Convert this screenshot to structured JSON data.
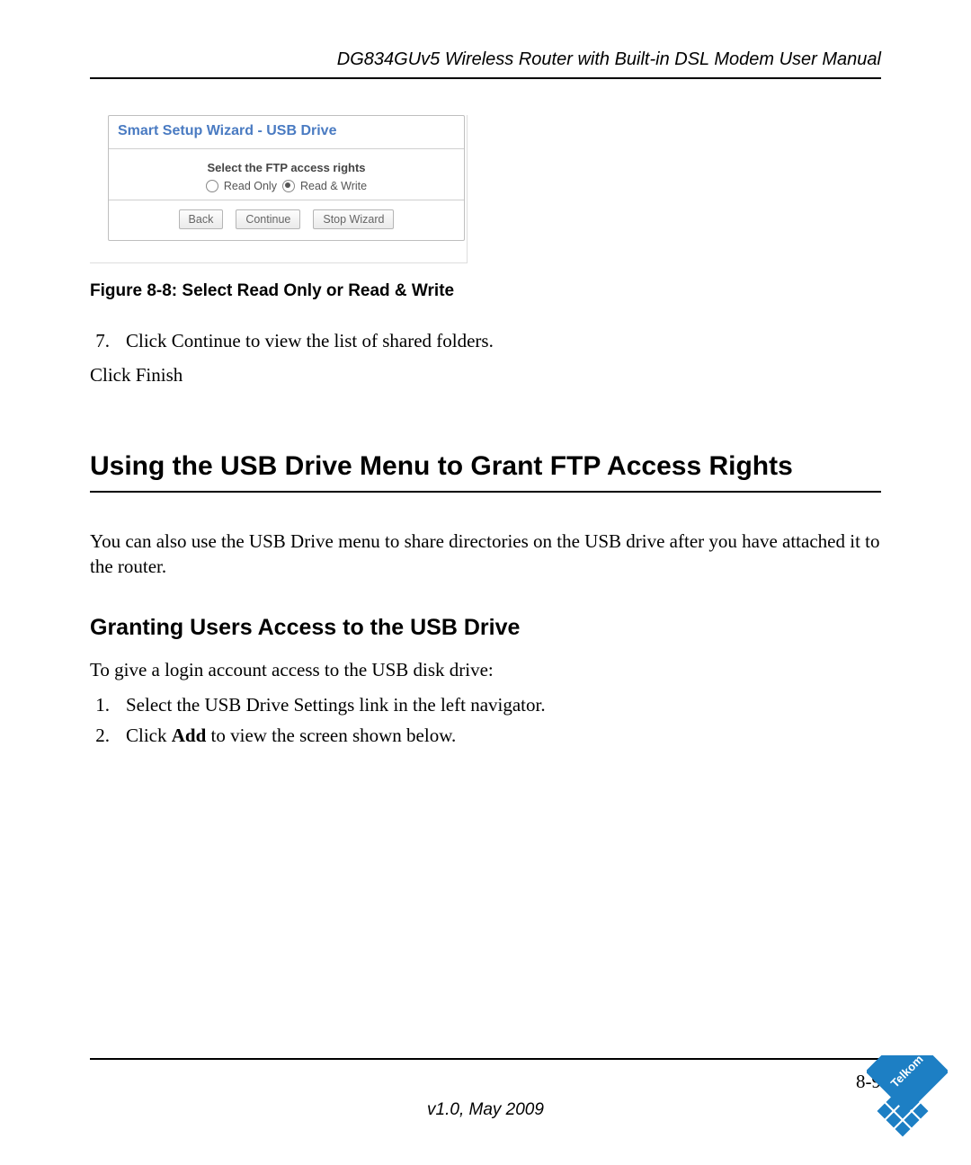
{
  "header": {
    "running_title": "DG834GUv5 Wireless Router with Built-in DSL Modem User Manual"
  },
  "wizard": {
    "title": "Smart Setup Wizard - USB Drive",
    "prompt": "Select the FTP access rights",
    "options": {
      "read_only": "Read Only",
      "read_write": "Read & Write",
      "selected": "read_write"
    },
    "buttons": {
      "back": "Back",
      "continue": "Continue",
      "stop": "Stop Wizard"
    }
  },
  "figure_caption": "Figure 8-8:  Select Read Only or Read & Write",
  "step7": {
    "number": "7.",
    "text": "Click Continue to view the list of shared folders."
  },
  "click_finish": "Click Finish",
  "section_title": "Using the USB Drive Menu to Grant FTP Access Rights",
  "section_intro": "You can also use the USB Drive menu to share directories on the USB drive after you have attached it to the router.",
  "subsection_title": "Granting Users Access to the USB Drive",
  "subsection_intro": "To give a login account access to the USB disk drive:",
  "steps": {
    "s1": {
      "number": "1.",
      "text": "Select the USB Drive Settings link in the left navigator."
    },
    "s2": {
      "number": "2.",
      "prefix": "Click ",
      "bold": "Add",
      "suffix": " to view the screen shown below."
    }
  },
  "footer": {
    "page_number": "8-9",
    "version": "v1.0, May 2009"
  },
  "logo": {
    "name": "Telkom"
  }
}
